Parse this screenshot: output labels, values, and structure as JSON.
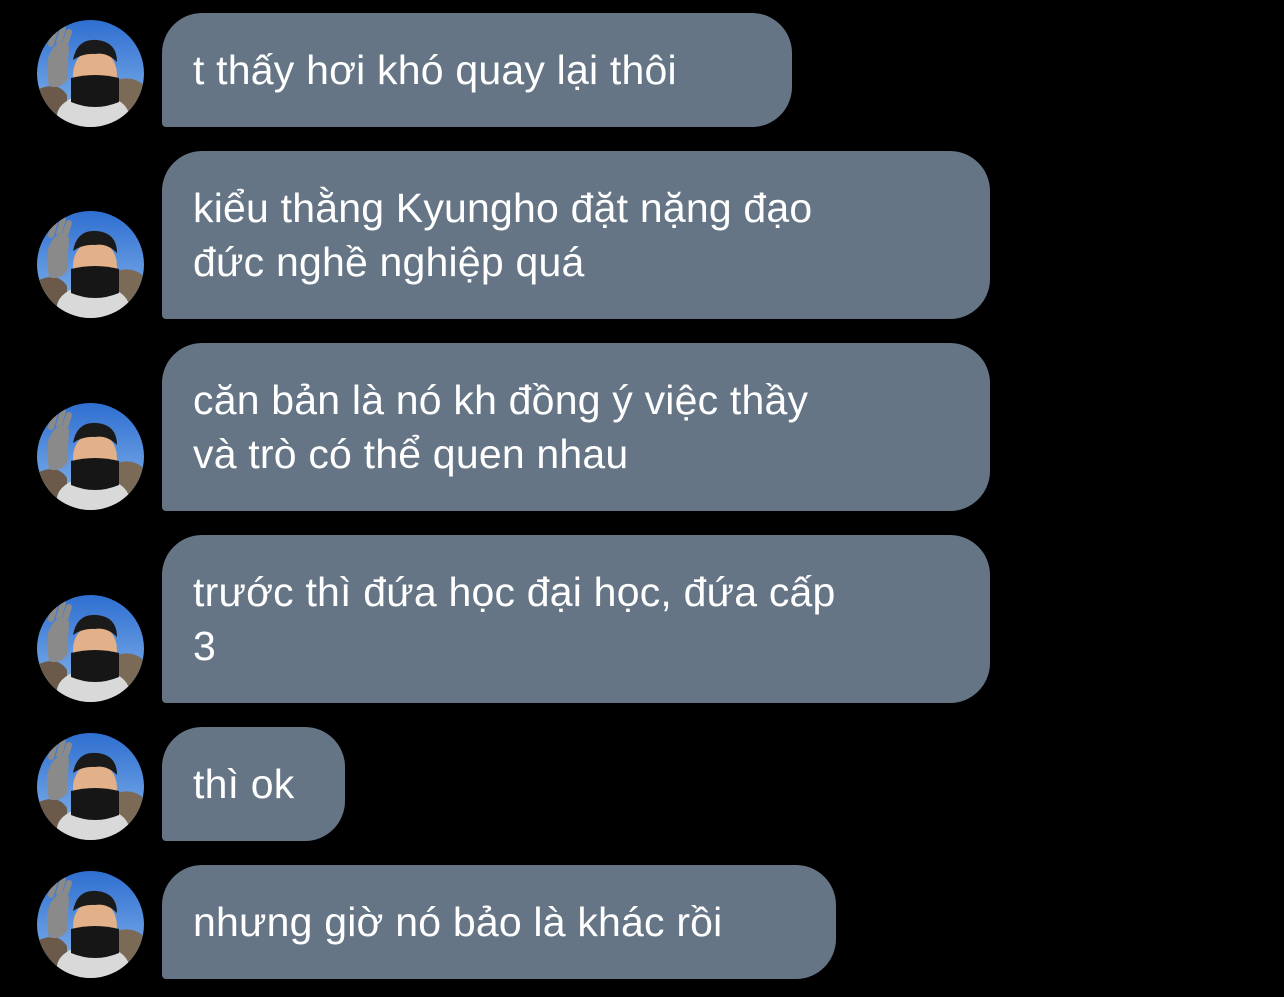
{
  "messages": [
    {
      "text": "t thấy hơi khó quay lại thôi",
      "avatar": "user-avatar"
    },
    {
      "text": "kiểu thằng Kyungho đặt nặng đạo\nđức nghề nghiệp quá",
      "avatar": "user-avatar"
    },
    {
      "text": "căn bản là nó kh đồng ý việc thầy\nvà trò có thể quen nhau",
      "avatar": "user-avatar"
    },
    {
      "text": "trước thì đứa học đại học, đứa cấp\n3",
      "avatar": "user-avatar"
    },
    {
      "text": "thì ok",
      "avatar": "user-avatar"
    },
    {
      "text": "nhưng giờ nó bảo là khác rồi",
      "avatar": "user-avatar"
    }
  ],
  "colors": {
    "background": "#000000",
    "bubble": "#657585",
    "text": "#ffffff"
  }
}
